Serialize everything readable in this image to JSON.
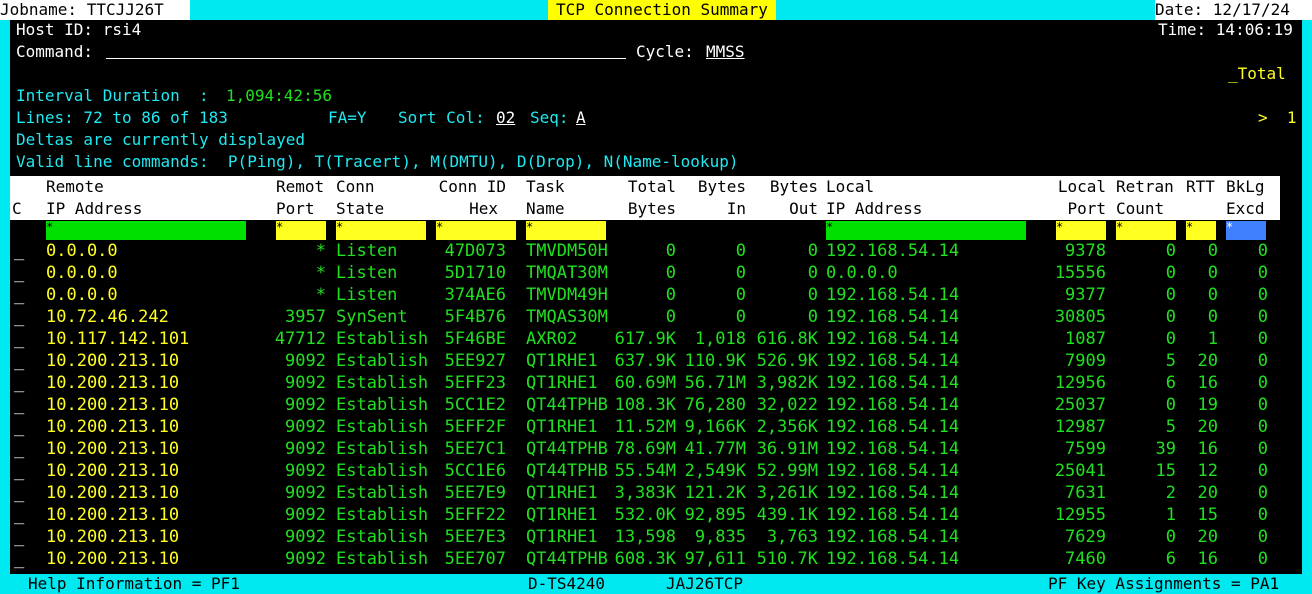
{
  "title_bar": {
    "jobname": "Jobname: TTCJJ26T",
    "title": "TCP Connection Summary",
    "date": "Date: 12/17/24"
  },
  "header": {
    "host_id": "Host ID: rsi4",
    "time": "Time: 14:06:19",
    "command_label": "Command:",
    "cycle_label": "Cycle:",
    "cycle_value": "MMSS",
    "total": "_Total",
    "interval_label": "Interval Duration  :",
    "interval_value": "1,094:42:56",
    "lines": "Lines: 72 to 86 of 183",
    "fa": "FA=Y",
    "sort_label": "Sort Col:",
    "sort_value": "02",
    "seq_label": "Seq:",
    "seq_value": "A",
    "scroll": ">  1",
    "deltas": "Deltas are currently displayed",
    "valid_cmds": "Valid line commands:  P(Ping), T(Tracert), M(DMTU), D(Drop), N(Name-lookup)"
  },
  "columns": {
    "c": "C",
    "remote_ip": [
      "Remote",
      "IP Address"
    ],
    "remote_port": [
      "Remot",
      "Port"
    ],
    "conn_state": [
      "Conn",
      "State"
    ],
    "conn_id": [
      "Conn ID",
      "Hex"
    ],
    "task": [
      "Task",
      "Name"
    ],
    "total_bytes": [
      "Total",
      "Bytes"
    ],
    "bytes_in": [
      "Bytes",
      "In"
    ],
    "bytes_out": [
      "Bytes",
      "Out"
    ],
    "local_ip": [
      "Local",
      "IP Address"
    ],
    "local_port": [
      "Local",
      "Port"
    ],
    "retran": [
      "Retran",
      "Count"
    ],
    "rtt": [
      "RTT",
      ""
    ],
    "bklg": [
      "BkLg",
      "Excd"
    ]
  },
  "filter_marker": "*",
  "rows": [
    {
      "sel": "_",
      "remote_ip": "0.0.0.0",
      "remote_port": "*",
      "state": "Listen",
      "conn_id": "47D073",
      "task": "TMVDM50H",
      "total": "0",
      "in": "0",
      "out": "0",
      "local_ip": "192.168.54.14",
      "local_port": "9378",
      "retran": "0",
      "rtt": "0",
      "bklg": "0"
    },
    {
      "sel": "_",
      "remote_ip": "0.0.0.0",
      "remote_port": "*",
      "state": "Listen",
      "conn_id": "5D1710",
      "task": "TMQAT30M",
      "total": "0",
      "in": "0",
      "out": "0",
      "local_ip": "0.0.0.0",
      "local_port": "15556",
      "retran": "0",
      "rtt": "0",
      "bklg": "0"
    },
    {
      "sel": "_",
      "remote_ip": "0.0.0.0",
      "remote_port": "*",
      "state": "Listen",
      "conn_id": "374AE6",
      "task": "TMVDM49H",
      "total": "0",
      "in": "0",
      "out": "0",
      "local_ip": "192.168.54.14",
      "local_port": "9377",
      "retran": "0",
      "rtt": "0",
      "bklg": "0"
    },
    {
      "sel": "_",
      "remote_ip": "10.72.46.242",
      "remote_port": "3957",
      "state": "SynSent",
      "conn_id": "5F4B76",
      "task": "TMQAS30M",
      "total": "0",
      "in": "0",
      "out": "0",
      "local_ip": "192.168.54.14",
      "local_port": "30805",
      "retran": "0",
      "rtt": "0",
      "bklg": "0"
    },
    {
      "sel": "_",
      "remote_ip": "10.117.142.101",
      "remote_port": "47712",
      "state": "Establish",
      "conn_id": "5F46BE",
      "task": "AXR02",
      "total": "617.9K",
      "in": "1,018",
      "out": "616.8K",
      "local_ip": "192.168.54.14",
      "local_port": "1087",
      "retran": "0",
      "rtt": "1",
      "bklg": "0"
    },
    {
      "sel": "_",
      "remote_ip": "10.200.213.10",
      "remote_port": "9092",
      "state": "Establish",
      "conn_id": "5EE927",
      "task": "QT1RHE1",
      "total": "637.9K",
      "in": "110.9K",
      "out": "526.9K",
      "local_ip": "192.168.54.14",
      "local_port": "7909",
      "retran": "5",
      "rtt": "20",
      "bklg": "0"
    },
    {
      "sel": "_",
      "remote_ip": "10.200.213.10",
      "remote_port": "9092",
      "state": "Establish",
      "conn_id": "5EFF23",
      "task": "QT1RHE1",
      "total": "60.69M",
      "in": "56.71M",
      "out": "3,982K",
      "local_ip": "192.168.54.14",
      "local_port": "12956",
      "retran": "6",
      "rtt": "16",
      "bklg": "0"
    },
    {
      "sel": "_",
      "remote_ip": "10.200.213.10",
      "remote_port": "9092",
      "state": "Establish",
      "conn_id": "5CC1E2",
      "task": "QT44TPHB",
      "total": "108.3K",
      "in": "76,280",
      "out": "32,022",
      "local_ip": "192.168.54.14",
      "local_port": "25037",
      "retran": "0",
      "rtt": "19",
      "bklg": "0"
    },
    {
      "sel": "_",
      "remote_ip": "10.200.213.10",
      "remote_port": "9092",
      "state": "Establish",
      "conn_id": "5EFF2F",
      "task": "QT1RHE1",
      "total": "11.52M",
      "in": "9,166K",
      "out": "2,356K",
      "local_ip": "192.168.54.14",
      "local_port": "12987",
      "retran": "5",
      "rtt": "20",
      "bklg": "0"
    },
    {
      "sel": "_",
      "remote_ip": "10.200.213.10",
      "remote_port": "9092",
      "state": "Establish",
      "conn_id": "5EE7C1",
      "task": "QT44TPHB",
      "total": "78.69M",
      "in": "41.77M",
      "out": "36.91M",
      "local_ip": "192.168.54.14",
      "local_port": "7599",
      "retran": "39",
      "rtt": "16",
      "bklg": "0"
    },
    {
      "sel": "_",
      "remote_ip": "10.200.213.10",
      "remote_port": "9092",
      "state": "Establish",
      "conn_id": "5CC1E6",
      "task": "QT44TPHB",
      "total": "55.54M",
      "in": "2,549K",
      "out": "52.99M",
      "local_ip": "192.168.54.14",
      "local_port": "25041",
      "retran": "15",
      "rtt": "12",
      "bklg": "0"
    },
    {
      "sel": "_",
      "remote_ip": "10.200.213.10",
      "remote_port": "9092",
      "state": "Establish",
      "conn_id": "5EE7E9",
      "task": "QT1RHE1",
      "total": "3,383K",
      "in": "121.2K",
      "out": "3,261K",
      "local_ip": "192.168.54.14",
      "local_port": "7631",
      "retran": "2",
      "rtt": "20",
      "bklg": "0"
    },
    {
      "sel": "_",
      "remote_ip": "10.200.213.10",
      "remote_port": "9092",
      "state": "Establish",
      "conn_id": "5EFF22",
      "task": "QT1RHE1",
      "total": "532.0K",
      "in": "92,895",
      "out": "439.1K",
      "local_ip": "192.168.54.14",
      "local_port": "12955",
      "retran": "1",
      "rtt": "15",
      "bklg": "0"
    },
    {
      "sel": "_",
      "remote_ip": "10.200.213.10",
      "remote_port": "9092",
      "state": "Establish",
      "conn_id": "5EE7E3",
      "task": "QT1RHE1",
      "total": "13,598",
      "in": "9,835",
      "out": "3,763",
      "local_ip": "192.168.54.14",
      "local_port": "7629",
      "retran": "0",
      "rtt": "20",
      "bklg": "0"
    },
    {
      "sel": "_",
      "remote_ip": "10.200.213.10",
      "remote_port": "9092",
      "state": "Establish",
      "conn_id": "5EE707",
      "task": "QT44TPHB",
      "total": "608.3K",
      "in": "97,611",
      "out": "510.7K",
      "local_ip": "192.168.54.14",
      "local_port": "7460",
      "retran": "6",
      "rtt": "16",
      "bklg": "0"
    }
  ],
  "status_bar": {
    "help": "Help Information = PF1",
    "terminal": "D-TS4240",
    "job": "JAJ26TCP",
    "pfkeys": "PF Key Assignments = PA1"
  },
  "colors": {
    "frame": "#00e8f0",
    "background": "#000000",
    "highlight": "#ffff00",
    "value_green": "#20e020",
    "ip_yellow": "#ffff20",
    "label_cyan": "#20e8f0"
  }
}
